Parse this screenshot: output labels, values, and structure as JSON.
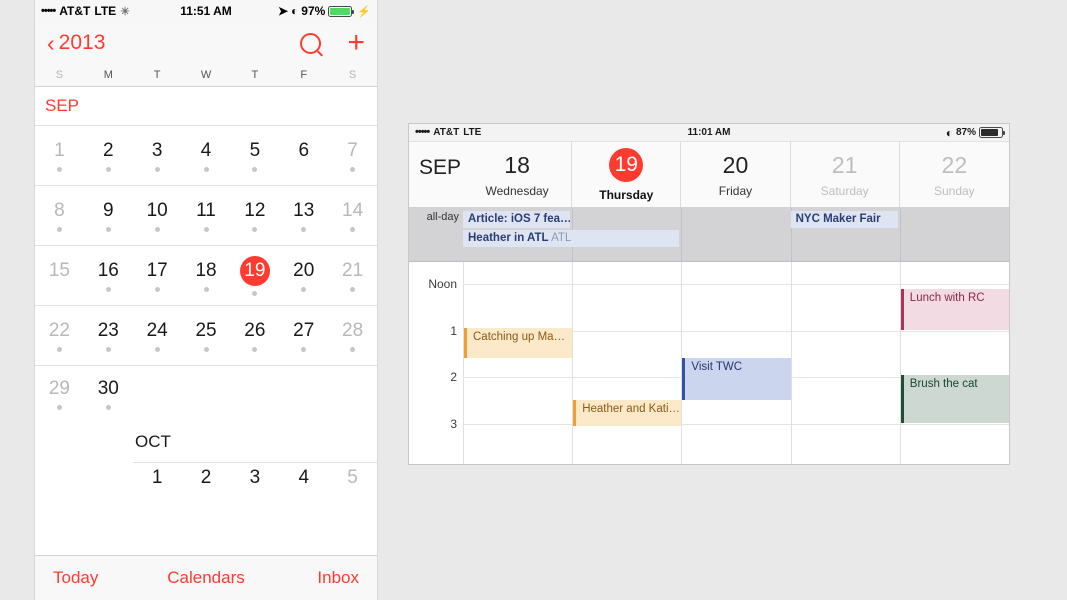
{
  "iphone": {
    "statusbar": {
      "signal_dots": "•••••",
      "carrier": "AT&T",
      "network": "LTE",
      "activity_icon": "spinner-icon",
      "time": "11:51 AM",
      "location_icon": "location-arrow-icon",
      "bluetooth_icon": "bluetooth-icon",
      "battery_percent": "97%",
      "battery_icon": "battery-charging-icon",
      "bolt_icon": "lightning-bolt-icon",
      "battery_color": "#4cd964",
      "battery_level": 97
    },
    "navbar": {
      "back_icon": "chevron-left-icon",
      "back_label": "2013",
      "search_icon": "search-icon",
      "add_icon": "plus-icon",
      "accent_color": "#ff3b30"
    },
    "weekday_headers": [
      {
        "label": "S",
        "dim": true
      },
      {
        "label": "M",
        "dim": false
      },
      {
        "label": "T",
        "dim": false
      },
      {
        "label": "W",
        "dim": false
      },
      {
        "label": "T",
        "dim": false
      },
      {
        "label": "F",
        "dim": false
      },
      {
        "label": "S",
        "dim": true
      }
    ],
    "month_sep": "SEP",
    "month_oct": "OCT",
    "weeks": [
      [
        {
          "num": "1",
          "weekend": true,
          "dot": true,
          "today": false
        },
        {
          "num": "2",
          "weekend": false,
          "dot": true,
          "today": false
        },
        {
          "num": "3",
          "weekend": false,
          "dot": true,
          "today": false
        },
        {
          "num": "4",
          "weekend": false,
          "dot": true,
          "today": false
        },
        {
          "num": "5",
          "weekend": false,
          "dot": true,
          "today": false
        },
        {
          "num": "6",
          "weekend": false,
          "dot": false,
          "today": false
        },
        {
          "num": "7",
          "weekend": true,
          "dot": true,
          "today": false
        }
      ],
      [
        {
          "num": "8",
          "weekend": true,
          "dot": true,
          "today": false
        },
        {
          "num": "9",
          "weekend": false,
          "dot": true,
          "today": false
        },
        {
          "num": "10",
          "weekend": false,
          "dot": true,
          "today": false
        },
        {
          "num": "11",
          "weekend": false,
          "dot": true,
          "today": false
        },
        {
          "num": "12",
          "weekend": false,
          "dot": true,
          "today": false
        },
        {
          "num": "13",
          "weekend": false,
          "dot": true,
          "today": false
        },
        {
          "num": "14",
          "weekend": true,
          "dot": true,
          "today": false
        }
      ],
      [
        {
          "num": "15",
          "weekend": true,
          "dot": false,
          "today": false
        },
        {
          "num": "16",
          "weekend": false,
          "dot": true,
          "today": false
        },
        {
          "num": "17",
          "weekend": false,
          "dot": true,
          "today": false
        },
        {
          "num": "18",
          "weekend": false,
          "dot": true,
          "today": false
        },
        {
          "num": "19",
          "weekend": false,
          "dot": true,
          "today": true
        },
        {
          "num": "20",
          "weekend": false,
          "dot": true,
          "today": false
        },
        {
          "num": "21",
          "weekend": true,
          "dot": true,
          "today": false
        }
      ],
      [
        {
          "num": "22",
          "weekend": true,
          "dot": true,
          "today": false
        },
        {
          "num": "23",
          "weekend": false,
          "dot": true,
          "today": false
        },
        {
          "num": "24",
          "weekend": false,
          "dot": true,
          "today": false
        },
        {
          "num": "25",
          "weekend": false,
          "dot": true,
          "today": false
        },
        {
          "num": "26",
          "weekend": false,
          "dot": true,
          "today": false
        },
        {
          "num": "27",
          "weekend": false,
          "dot": true,
          "today": false
        },
        {
          "num": "28",
          "weekend": true,
          "dot": true,
          "today": false
        }
      ],
      [
        {
          "num": "29",
          "weekend": true,
          "dot": true,
          "today": false
        },
        {
          "num": "30",
          "weekend": false,
          "dot": true,
          "today": false
        },
        {
          "num": "",
          "weekend": false,
          "dot": false,
          "today": false,
          "empty": true
        },
        {
          "num": "",
          "weekend": false,
          "dot": false,
          "today": false,
          "empty": true
        },
        {
          "num": "",
          "weekend": false,
          "dot": false,
          "today": false,
          "empty": true
        },
        {
          "num": "",
          "weekend": false,
          "dot": false,
          "today": false,
          "empty": true
        },
        {
          "num": "",
          "weekend": true,
          "dot": false,
          "today": false,
          "empty": true
        }
      ]
    ],
    "oct_week": [
      {
        "num": "",
        "weekend": true,
        "dot": false,
        "empty": true
      },
      {
        "num": "",
        "weekend": false,
        "dot": false,
        "empty": true
      },
      {
        "num": "1",
        "weekend": false,
        "dot": false,
        "empty": false
      },
      {
        "num": "2",
        "weekend": false,
        "dot": false,
        "empty": false
      },
      {
        "num": "3",
        "weekend": false,
        "dot": false,
        "empty": false
      },
      {
        "num": "4",
        "weekend": false,
        "dot": false,
        "empty": false
      },
      {
        "num": "5",
        "weekend": true,
        "dot": false,
        "empty": false
      }
    ],
    "tabbar": [
      {
        "label": "Today"
      },
      {
        "label": "Calendars"
      },
      {
        "label": "Inbox"
      }
    ]
  },
  "ipad": {
    "statusbar": {
      "signal_dots": "•••••",
      "carrier": "AT&T",
      "network": "LTE",
      "time": "11:01 AM",
      "bluetooth_icon": "bluetooth-icon",
      "battery_percent": "87%",
      "battery_icon": "battery-icon",
      "battery_level": 87
    },
    "month": "SEP",
    "days": [
      {
        "num": "18",
        "name": "Wednesday",
        "dim": false,
        "today": false
      },
      {
        "num": "19",
        "name": "Thursday",
        "dim": false,
        "today": true
      },
      {
        "num": "20",
        "name": "Friday",
        "dim": false,
        "today": false
      },
      {
        "num": "21",
        "name": "Saturday",
        "dim": true,
        "today": false
      },
      {
        "num": "22",
        "name": "Sunday",
        "dim": true,
        "today": false
      }
    ],
    "allday_label": "all-day",
    "allday_events": [
      {
        "title": "Article: iOS 7 fea…",
        "location": "",
        "col_start": 0,
        "col_span": 1,
        "row": 0
      },
      {
        "title": "Heather in ATL",
        "location": "ATL",
        "col_start": 0,
        "col_span": 2,
        "row": 1
      },
      {
        "title": "NYC Maker Fair",
        "location": "",
        "col_start": 3,
        "col_span": 1,
        "row": 0
      }
    ],
    "time_labels": [
      "Noon",
      "1",
      "2",
      "3"
    ],
    "events": [
      {
        "title": "Catching up Ma…",
        "color": "orange",
        "col": 0,
        "start_hour": 12.95,
        "end_hour": 13.6
      },
      {
        "title": "Heather and Kati…",
        "color": "orange",
        "col": 1,
        "start_hour": 14.5,
        "end_hour": 15.05
      },
      {
        "title": "Visit TWC",
        "color": "blue",
        "col": 2,
        "start_hour": 13.6,
        "end_hour": 14.5
      },
      {
        "title": "Lunch with RC",
        "color": "pink",
        "col": 4,
        "start_hour": 12.1,
        "end_hour": 13.0
      },
      {
        "title": "Brush the cat",
        "color": "green",
        "col": 4,
        "start_hour": 13.95,
        "end_hour": 15.0
      }
    ],
    "colors": {
      "orange": "#f0a030",
      "blue": "#33539e",
      "pink": "#a8355a",
      "green": "#1f4d38",
      "today": "#ff3b30"
    }
  }
}
